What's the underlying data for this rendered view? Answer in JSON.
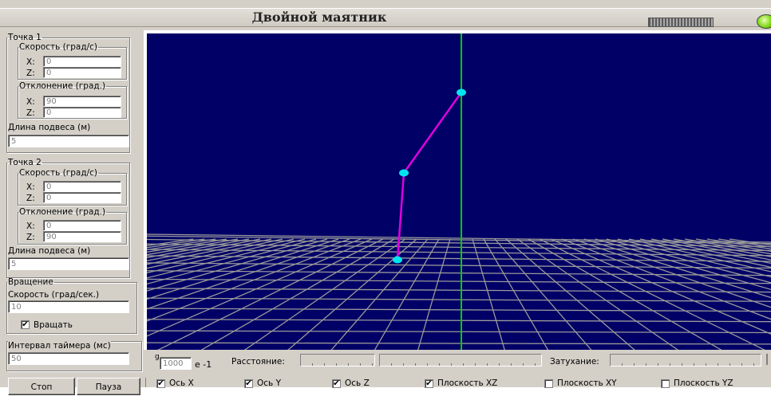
{
  "window": {
    "title": "Двойной маятник"
  },
  "point1": {
    "legend": "Точка 1",
    "speed": {
      "legend": "Скорость (град/с)",
      "x_label": "X:",
      "x_value": "0",
      "z_label": "Z:",
      "z_value": "0"
    },
    "deviation": {
      "legend": "Отклонение (град.)",
      "x_label": "X:",
      "x_value": "90",
      "z_label": "Z:",
      "z_value": "0"
    },
    "length_label": "Длина подвеса (м)",
    "length_value": "5"
  },
  "point2": {
    "legend": "Точка 2",
    "speed": {
      "legend": "Скорость (град/с)",
      "x_label": "X:",
      "x_value": "0",
      "z_label": "Z:",
      "z_value": "0"
    },
    "deviation": {
      "legend": "Отклонение (град.)",
      "x_label": "X:",
      "x_value": "0",
      "z_label": "Z:",
      "z_value": "90"
    },
    "length_label": "Длина подвеса (м)",
    "length_value": "5"
  },
  "rotation": {
    "legend": "Вращение",
    "speed_label": "Скорость (град/сек.)",
    "speed_value": "10",
    "rotate_label": "Вращать",
    "rotate_checked": "✔"
  },
  "timer": {
    "label": "Интервал таймера (мс)",
    "value": "50"
  },
  "buttons": {
    "stop": "Стоп",
    "pause": "Пауза"
  },
  "gravity": {
    "label": "g",
    "value": "1000",
    "exponent": "е -1"
  },
  "sliders": {
    "distance_label": "Расстояние:",
    "damping_label": "Затухание:"
  },
  "checkboxes": [
    {
      "label": "Ось X",
      "checked": "✔"
    },
    {
      "label": "Ось Y",
      "checked": "✔"
    },
    {
      "label": "Ось Z",
      "checked": "✔"
    },
    {
      "label": "Плоскость XZ",
      "checked": "✔"
    },
    {
      "label": "Плоскость XY",
      "checked": ""
    },
    {
      "label": "Плоскость YZ",
      "checked": ""
    }
  ],
  "colors": {
    "background": "#000066",
    "grid": "#9a9a9a",
    "axis": "#00cc00",
    "rod": "#e000e0",
    "bob": "#00e5ee"
  }
}
